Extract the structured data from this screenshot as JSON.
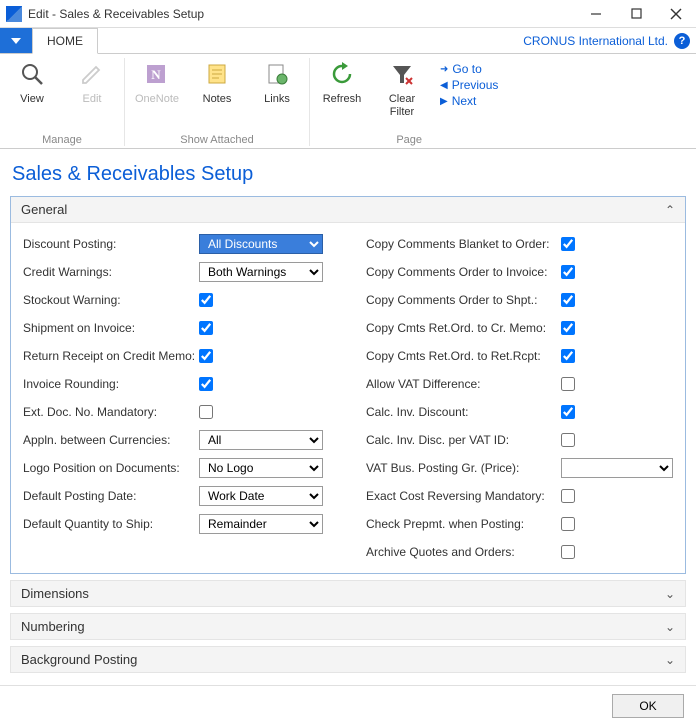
{
  "window": {
    "title": "Edit - Sales & Receivables Setup"
  },
  "company": "CRONUS International Ltd.",
  "ribbon_tab": "HOME",
  "ribbon": {
    "manage": {
      "label": "Manage",
      "view": "View",
      "edit": "Edit"
    },
    "attached": {
      "label": "Show Attached",
      "onenote": "OneNote",
      "notes": "Notes",
      "links": "Links"
    },
    "page": {
      "label": "Page",
      "refresh": "Refresh",
      "clear_filter": "Clear Filter",
      "goto": "Go to",
      "previous": "Previous",
      "next": "Next"
    }
  },
  "page_title": "Sales & Receivables Setup",
  "sections": {
    "general": "General",
    "dimensions": "Dimensions",
    "numbering": "Numbering",
    "background": "Background Posting"
  },
  "fields": {
    "discount_posting": {
      "label": "Discount Posting:",
      "value": "All Discounts"
    },
    "credit_warnings": {
      "label": "Credit Warnings:",
      "value": "Both Warnings"
    },
    "stockout_warning": {
      "label": "Stockout Warning:",
      "checked": true
    },
    "shipment_on_invoice": {
      "label": "Shipment on Invoice:",
      "checked": true
    },
    "return_receipt": {
      "label": "Return Receipt on Credit Memo:",
      "checked": true
    },
    "invoice_rounding": {
      "label": "Invoice Rounding:",
      "checked": true
    },
    "ext_doc_mandatory": {
      "label": "Ext. Doc. No. Mandatory:",
      "checked": false
    },
    "appln_currencies": {
      "label": "Appln. between Currencies:",
      "value": "All"
    },
    "logo_position": {
      "label": "Logo Position on Documents:",
      "value": "No Logo"
    },
    "default_posting_date": {
      "label": "Default Posting Date:",
      "value": "Work Date"
    },
    "default_qty_ship": {
      "label": "Default Quantity to Ship:",
      "value": "Remainder"
    },
    "copy_blanket_order": {
      "label": "Copy Comments Blanket to Order:",
      "checked": true
    },
    "copy_order_invoice": {
      "label": "Copy Comments Order to Invoice:",
      "checked": true
    },
    "copy_order_shpt": {
      "label": "Copy Comments Order to Shpt.:",
      "checked": true
    },
    "copy_retord_crmemo": {
      "label": "Copy Cmts Ret.Ord. to Cr. Memo:",
      "checked": true
    },
    "copy_retord_retrcpt": {
      "label": "Copy Cmts Ret.Ord. to Ret.Rcpt:",
      "checked": true
    },
    "allow_vat_diff": {
      "label": "Allow VAT Difference:",
      "checked": false
    },
    "calc_inv_disc": {
      "label": "Calc. Inv. Discount:",
      "checked": true
    },
    "calc_inv_disc_vat": {
      "label": "Calc. Inv. Disc. per VAT ID:",
      "checked": false
    },
    "vat_bus_posting": {
      "label": "VAT Bus. Posting Gr. (Price):",
      "value": ""
    },
    "exact_cost_reversing": {
      "label": "Exact Cost Reversing Mandatory:",
      "checked": false
    },
    "check_prepmt": {
      "label": "Check Prepmt. when Posting:",
      "checked": false
    },
    "archive_quotes": {
      "label": "Archive Quotes and Orders:",
      "checked": false
    }
  },
  "footer": {
    "ok": "OK"
  }
}
